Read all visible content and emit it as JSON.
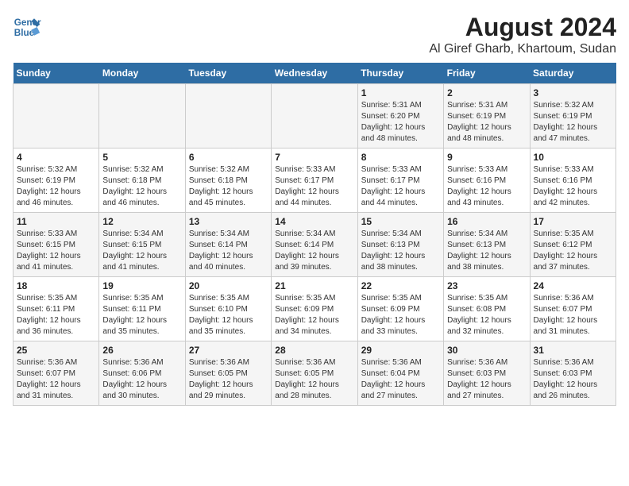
{
  "header": {
    "logo_line1": "General",
    "logo_line2": "Blue",
    "title": "August 2024",
    "subtitle": "Al Giref Gharb, Khartoum, Sudan"
  },
  "days_of_week": [
    "Sunday",
    "Monday",
    "Tuesday",
    "Wednesday",
    "Thursday",
    "Friday",
    "Saturday"
  ],
  "weeks": [
    [
      {
        "day": "",
        "info": ""
      },
      {
        "day": "",
        "info": ""
      },
      {
        "day": "",
        "info": ""
      },
      {
        "day": "",
        "info": ""
      },
      {
        "day": "1",
        "info": "Sunrise: 5:31 AM\nSunset: 6:20 PM\nDaylight: 12 hours\nand 48 minutes."
      },
      {
        "day": "2",
        "info": "Sunrise: 5:31 AM\nSunset: 6:19 PM\nDaylight: 12 hours\nand 48 minutes."
      },
      {
        "day": "3",
        "info": "Sunrise: 5:32 AM\nSunset: 6:19 PM\nDaylight: 12 hours\nand 47 minutes."
      }
    ],
    [
      {
        "day": "4",
        "info": "Sunrise: 5:32 AM\nSunset: 6:19 PM\nDaylight: 12 hours\nand 46 minutes."
      },
      {
        "day": "5",
        "info": "Sunrise: 5:32 AM\nSunset: 6:18 PM\nDaylight: 12 hours\nand 46 minutes."
      },
      {
        "day": "6",
        "info": "Sunrise: 5:32 AM\nSunset: 6:18 PM\nDaylight: 12 hours\nand 45 minutes."
      },
      {
        "day": "7",
        "info": "Sunrise: 5:33 AM\nSunset: 6:17 PM\nDaylight: 12 hours\nand 44 minutes."
      },
      {
        "day": "8",
        "info": "Sunrise: 5:33 AM\nSunset: 6:17 PM\nDaylight: 12 hours\nand 44 minutes."
      },
      {
        "day": "9",
        "info": "Sunrise: 5:33 AM\nSunset: 6:16 PM\nDaylight: 12 hours\nand 43 minutes."
      },
      {
        "day": "10",
        "info": "Sunrise: 5:33 AM\nSunset: 6:16 PM\nDaylight: 12 hours\nand 42 minutes."
      }
    ],
    [
      {
        "day": "11",
        "info": "Sunrise: 5:33 AM\nSunset: 6:15 PM\nDaylight: 12 hours\nand 41 minutes."
      },
      {
        "day": "12",
        "info": "Sunrise: 5:34 AM\nSunset: 6:15 PM\nDaylight: 12 hours\nand 41 minutes."
      },
      {
        "day": "13",
        "info": "Sunrise: 5:34 AM\nSunset: 6:14 PM\nDaylight: 12 hours\nand 40 minutes."
      },
      {
        "day": "14",
        "info": "Sunrise: 5:34 AM\nSunset: 6:14 PM\nDaylight: 12 hours\nand 39 minutes."
      },
      {
        "day": "15",
        "info": "Sunrise: 5:34 AM\nSunset: 6:13 PM\nDaylight: 12 hours\nand 38 minutes."
      },
      {
        "day": "16",
        "info": "Sunrise: 5:34 AM\nSunset: 6:13 PM\nDaylight: 12 hours\nand 38 minutes."
      },
      {
        "day": "17",
        "info": "Sunrise: 5:35 AM\nSunset: 6:12 PM\nDaylight: 12 hours\nand 37 minutes."
      }
    ],
    [
      {
        "day": "18",
        "info": "Sunrise: 5:35 AM\nSunset: 6:11 PM\nDaylight: 12 hours\nand 36 minutes."
      },
      {
        "day": "19",
        "info": "Sunrise: 5:35 AM\nSunset: 6:11 PM\nDaylight: 12 hours\nand 35 minutes."
      },
      {
        "day": "20",
        "info": "Sunrise: 5:35 AM\nSunset: 6:10 PM\nDaylight: 12 hours\nand 35 minutes."
      },
      {
        "day": "21",
        "info": "Sunrise: 5:35 AM\nSunset: 6:09 PM\nDaylight: 12 hours\nand 34 minutes."
      },
      {
        "day": "22",
        "info": "Sunrise: 5:35 AM\nSunset: 6:09 PM\nDaylight: 12 hours\nand 33 minutes."
      },
      {
        "day": "23",
        "info": "Sunrise: 5:35 AM\nSunset: 6:08 PM\nDaylight: 12 hours\nand 32 minutes."
      },
      {
        "day": "24",
        "info": "Sunrise: 5:36 AM\nSunset: 6:07 PM\nDaylight: 12 hours\nand 31 minutes."
      }
    ],
    [
      {
        "day": "25",
        "info": "Sunrise: 5:36 AM\nSunset: 6:07 PM\nDaylight: 12 hours\nand 31 minutes."
      },
      {
        "day": "26",
        "info": "Sunrise: 5:36 AM\nSunset: 6:06 PM\nDaylight: 12 hours\nand 30 minutes."
      },
      {
        "day": "27",
        "info": "Sunrise: 5:36 AM\nSunset: 6:05 PM\nDaylight: 12 hours\nand 29 minutes."
      },
      {
        "day": "28",
        "info": "Sunrise: 5:36 AM\nSunset: 6:05 PM\nDaylight: 12 hours\nand 28 minutes."
      },
      {
        "day": "29",
        "info": "Sunrise: 5:36 AM\nSunset: 6:04 PM\nDaylight: 12 hours\nand 27 minutes."
      },
      {
        "day": "30",
        "info": "Sunrise: 5:36 AM\nSunset: 6:03 PM\nDaylight: 12 hours\nand 27 minutes."
      },
      {
        "day": "31",
        "info": "Sunrise: 5:36 AM\nSunset: 6:03 PM\nDaylight: 12 hours\nand 26 minutes."
      }
    ]
  ]
}
